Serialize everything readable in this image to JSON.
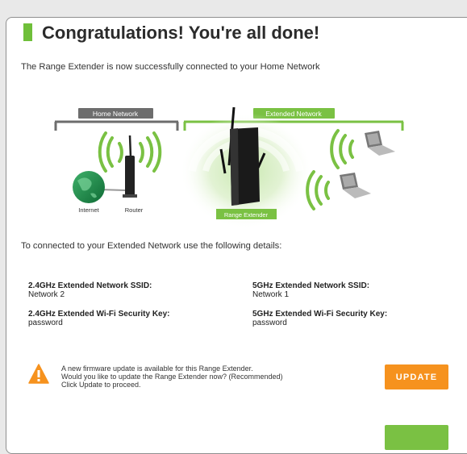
{
  "header": {
    "title": "Congratulations! You're all done!",
    "subtitle": "The Range Extender is now successfully connected to your Home Network"
  },
  "diagram": {
    "home_network_label": "Home Network",
    "extended_network_label": "Extended Network",
    "internet_label": "Internet",
    "router_label": "Router",
    "range_extender_label": "Range Extender",
    "colors": {
      "green": "#7ac143",
      "gray": "#6d6d6d"
    }
  },
  "details": {
    "intro": "To connected to your Extended Network use the following details:",
    "ssid_24_label": "2.4GHz Extended Network SSID:",
    "ssid_24_value": "Network 2",
    "ssid_5_label": "5GHz Extended Network SSID:",
    "ssid_5_value": "Network 1",
    "key_24_label": "2.4GHz Extended Wi-Fi Security Key:",
    "key_24_value": "password",
    "key_5_label": "5GHz Extended Wi-Fi Security Key:",
    "key_5_value": "password"
  },
  "firmware": {
    "line1": "A new firmware update is available for this Range Extender.",
    "line2": "Would you like to update the Range Extender now? (Recommended)",
    "line3": "Click Update to proceed.",
    "update_label": "UPDATE",
    "warning_color": "#f6921e"
  }
}
